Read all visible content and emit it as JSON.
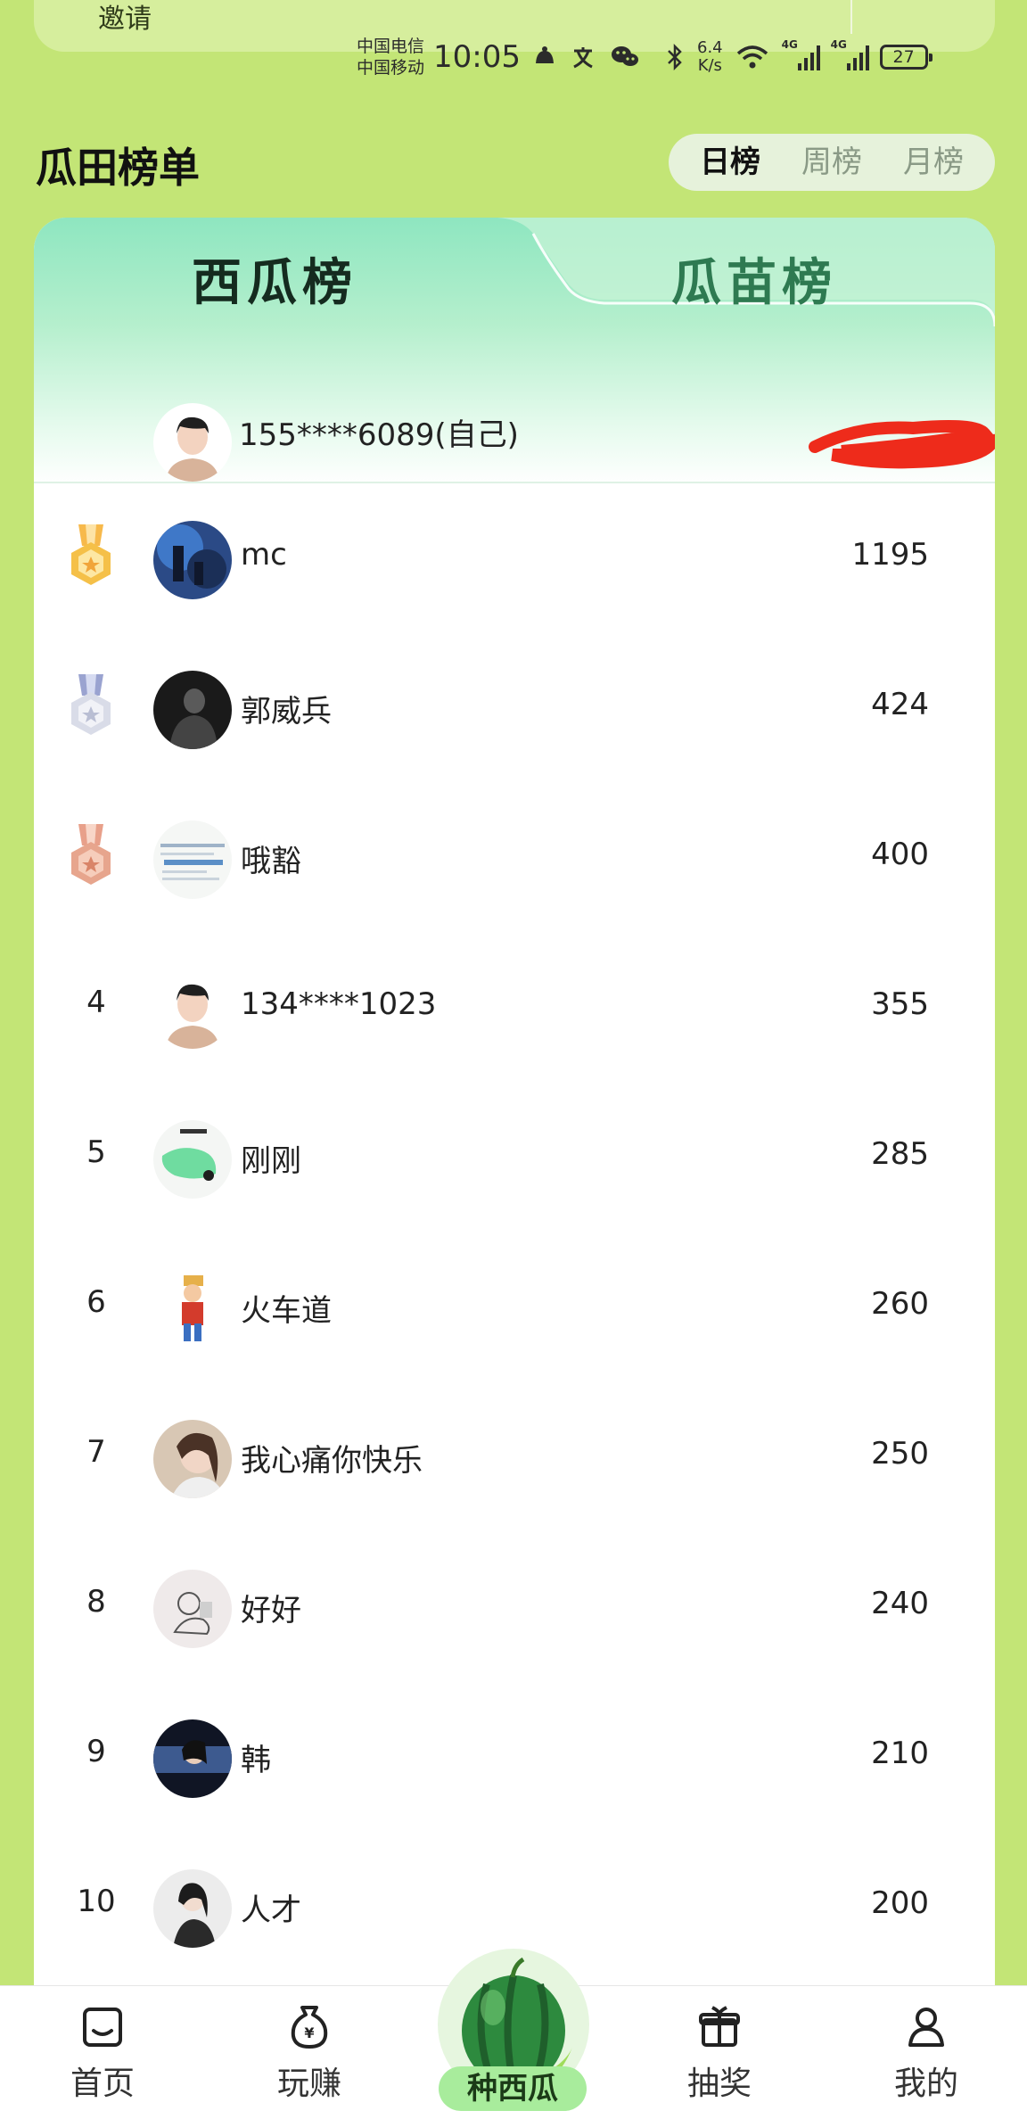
{
  "top_card": {
    "text": "邀请"
  },
  "status_bar": {
    "carrier1": "中国电信",
    "carrier2": "中国移动",
    "time": "10:05",
    "speed_value": "6.4",
    "speed_unit": "K/s",
    "net1": "4G",
    "net2": "4G",
    "battery": "27"
  },
  "header": {
    "title": "瓜田榜单",
    "period_tabs": [
      {
        "label": "日榜",
        "active": true
      },
      {
        "label": "周榜",
        "active": false
      },
      {
        "label": "月榜",
        "active": false
      }
    ]
  },
  "board": {
    "tabs": [
      {
        "label": "西瓜榜",
        "active": true
      },
      {
        "label": "瓜苗榜",
        "active": false
      }
    ],
    "self": {
      "name": "155****6089(自己)",
      "score_redacted": true
    }
  },
  "ranking": [
    {
      "rank": "1",
      "medal": "gold",
      "name": "mc",
      "score": "1195"
    },
    {
      "rank": "2",
      "medal": "silver",
      "name": "郭威兵",
      "score": "424"
    },
    {
      "rank": "3",
      "medal": "bronze",
      "name": "哦豁",
      "score": "400"
    },
    {
      "rank": "4",
      "name": "134****1023",
      "score": "355"
    },
    {
      "rank": "5",
      "name": "刚刚",
      "score": "285"
    },
    {
      "rank": "6",
      "name": "火车道",
      "score": "260"
    },
    {
      "rank": "7",
      "name": "我心痛你快乐",
      "score": "250"
    },
    {
      "rank": "8",
      "name": "好好",
      "score": "240"
    },
    {
      "rank": "9",
      "name": "韩",
      "score": "210"
    },
    {
      "rank": "10",
      "name": "人才",
      "score": "200"
    }
  ],
  "bottom_nav": {
    "home": "首页",
    "earn": "玩赚",
    "center": "种西瓜",
    "lottery": "抽奖",
    "mine": "我的"
  },
  "colors": {
    "page_bg": "#c3e576",
    "board_gradient_top": "#8ee6c0",
    "tab_active": "#152b1f",
    "tab_inactive": "#2e7a51",
    "center_pill": "#a8ec9c",
    "redaction": "#ee2b1b"
  }
}
